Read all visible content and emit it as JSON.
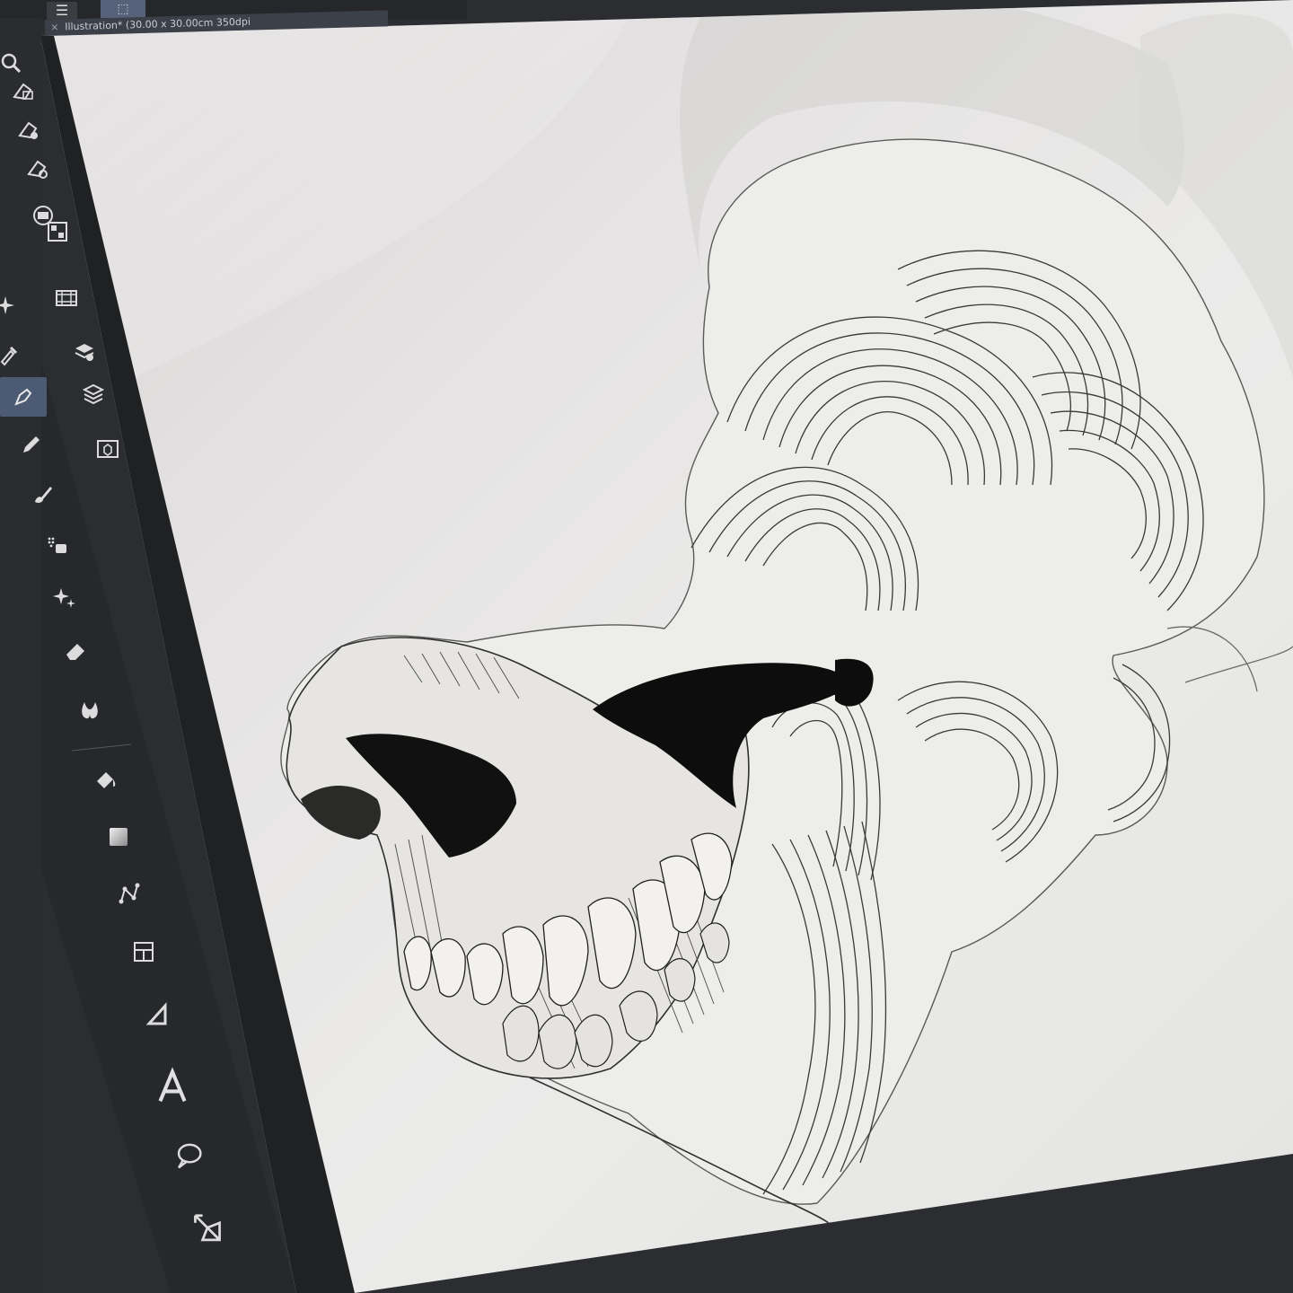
{
  "document_tab": {
    "title": "Illustration* (30.00 x 30.00cm 350dpi"
  },
  "toolbar": {
    "menu_icon": "hamburger-menu-icon"
  },
  "command_bar": [
    {
      "name": "new-material-icon"
    },
    {
      "name": "material-settings-icon"
    },
    {
      "name": "material-view-icon"
    },
    {
      "name": "navigator-icon"
    },
    {
      "name": "color-palette-icon"
    },
    {
      "name": "animation-timeline-icon"
    },
    {
      "name": "layer-properties-icon"
    },
    {
      "name": "layers-icon"
    },
    {
      "name": "3d-object-icon"
    }
  ],
  "tools": [
    {
      "name": "pen-tool",
      "active": true
    },
    {
      "name": "pencil-tool",
      "active": false
    },
    {
      "name": "brush-tool",
      "active": false
    },
    {
      "name": "airbrush-tool",
      "active": false
    },
    {
      "name": "decoration-tool",
      "active": false
    },
    {
      "name": "eraser-tool",
      "active": false
    },
    {
      "name": "blend-tool",
      "active": false
    },
    {
      "name": "fill-tool",
      "active": false
    },
    {
      "name": "gradient-tool",
      "active": false
    },
    {
      "name": "figure-tool",
      "active": false
    },
    {
      "name": "frame-border-tool",
      "active": false
    },
    {
      "name": "ruler-tool",
      "active": false
    },
    {
      "name": "text-tool",
      "active": false
    },
    {
      "name": "balloon-tool",
      "active": false
    },
    {
      "name": "correct-line-tool",
      "active": false
    }
  ],
  "canvas": {
    "subject": "ink illustration of a skull with swirling contour-line smoke"
  }
}
